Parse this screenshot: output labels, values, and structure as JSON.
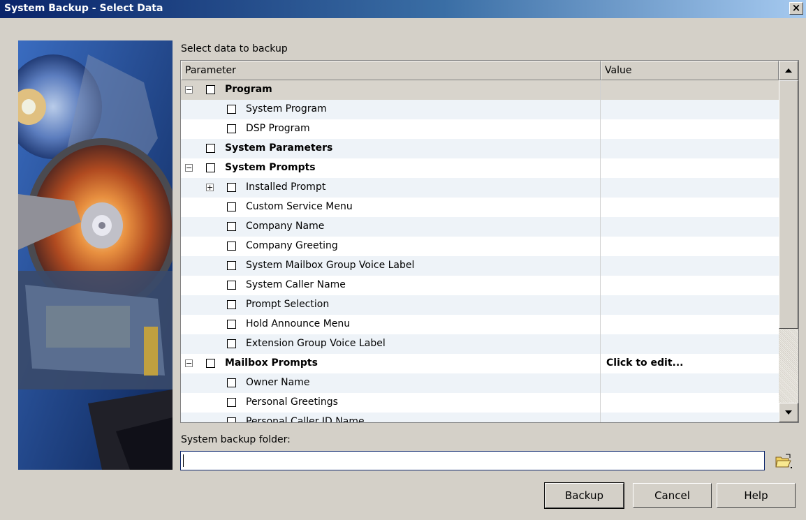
{
  "window": {
    "title": "System Backup - Select Data",
    "close_glyph": "×"
  },
  "labels": {
    "select_data": "Select data to backup",
    "backup_folder": "System backup folder:"
  },
  "grid": {
    "columns": [
      "Parameter",
      "Value"
    ],
    "rows": [
      {
        "label": "Program",
        "level": 0,
        "bold": true,
        "expander": "−",
        "value": ""
      },
      {
        "label": "System Program",
        "level": 1,
        "bold": false,
        "expander": "",
        "value": ""
      },
      {
        "label": "DSP Program",
        "level": 1,
        "bold": false,
        "expander": "",
        "value": ""
      },
      {
        "label": "System Parameters",
        "level": 0,
        "bold": true,
        "expander": "",
        "value": ""
      },
      {
        "label": "System Prompts",
        "level": 0,
        "bold": true,
        "expander": "−",
        "value": ""
      },
      {
        "label": "Installed Prompt",
        "level": 1,
        "bold": false,
        "expander": "+",
        "value": ""
      },
      {
        "label": "Custom Service Menu",
        "level": 1,
        "bold": false,
        "expander": "",
        "value": ""
      },
      {
        "label": "Company Name",
        "level": 1,
        "bold": false,
        "expander": "",
        "value": ""
      },
      {
        "label": "Company Greeting",
        "level": 1,
        "bold": false,
        "expander": "",
        "value": ""
      },
      {
        "label": "System Mailbox Group Voice Label",
        "level": 1,
        "bold": false,
        "expander": "",
        "value": ""
      },
      {
        "label": "System Caller Name",
        "level": 1,
        "bold": false,
        "expander": "",
        "value": ""
      },
      {
        "label": "Prompt Selection",
        "level": 1,
        "bold": false,
        "expander": "",
        "value": ""
      },
      {
        "label": "Hold Announce Menu",
        "level": 1,
        "bold": false,
        "expander": "",
        "value": ""
      },
      {
        "label": "Extension Group Voice Label",
        "level": 1,
        "bold": false,
        "expander": "",
        "value": ""
      },
      {
        "label": "Mailbox Prompts",
        "level": 0,
        "bold": true,
        "expander": "−",
        "value": "Click to edit..."
      },
      {
        "label": "Owner Name",
        "level": 1,
        "bold": false,
        "expander": "",
        "value": ""
      },
      {
        "label": "Personal Greetings",
        "level": 1,
        "bold": false,
        "expander": "",
        "value": ""
      },
      {
        "label": "Personal Caller ID Name",
        "level": 1,
        "bold": false,
        "expander": "",
        "value": ""
      }
    ]
  },
  "folder_input": {
    "value": ""
  },
  "buttons": {
    "backup": "Backup",
    "cancel": "Cancel",
    "help": "Help"
  },
  "icons": {
    "close": "close-icon",
    "browse": "folder-open-icon",
    "scroll_up": "arrow-up-icon",
    "scroll_down": "arrow-down-icon"
  }
}
